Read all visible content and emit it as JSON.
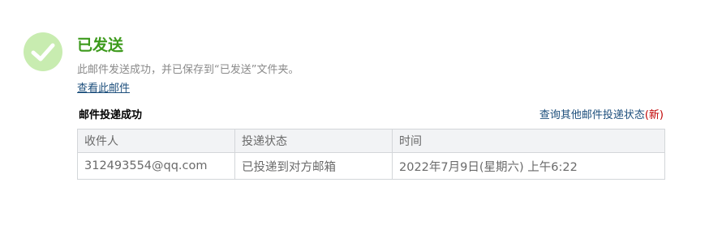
{
  "result": {
    "title": "已发送",
    "description": "此邮件发送成功，并已保存到“已发送”文件夹。",
    "view_link": "查看此邮件",
    "icon": "check-circle-icon",
    "icon_color": "#c8ecb0",
    "title_color": "#3d9a1c"
  },
  "delivery": {
    "heading": "邮件投递成功",
    "query_link": "查询其他邮件投递状态",
    "query_new_open": "(",
    "query_new_label": "新",
    "query_new_close": ")",
    "columns": [
      "收件人",
      "投递状态",
      "时间"
    ],
    "rows": [
      {
        "recipient": "312493554@qq.com",
        "status": "已投递到对方邮箱",
        "time": "2022年7月9日(星期六) 上午6:22"
      }
    ]
  }
}
